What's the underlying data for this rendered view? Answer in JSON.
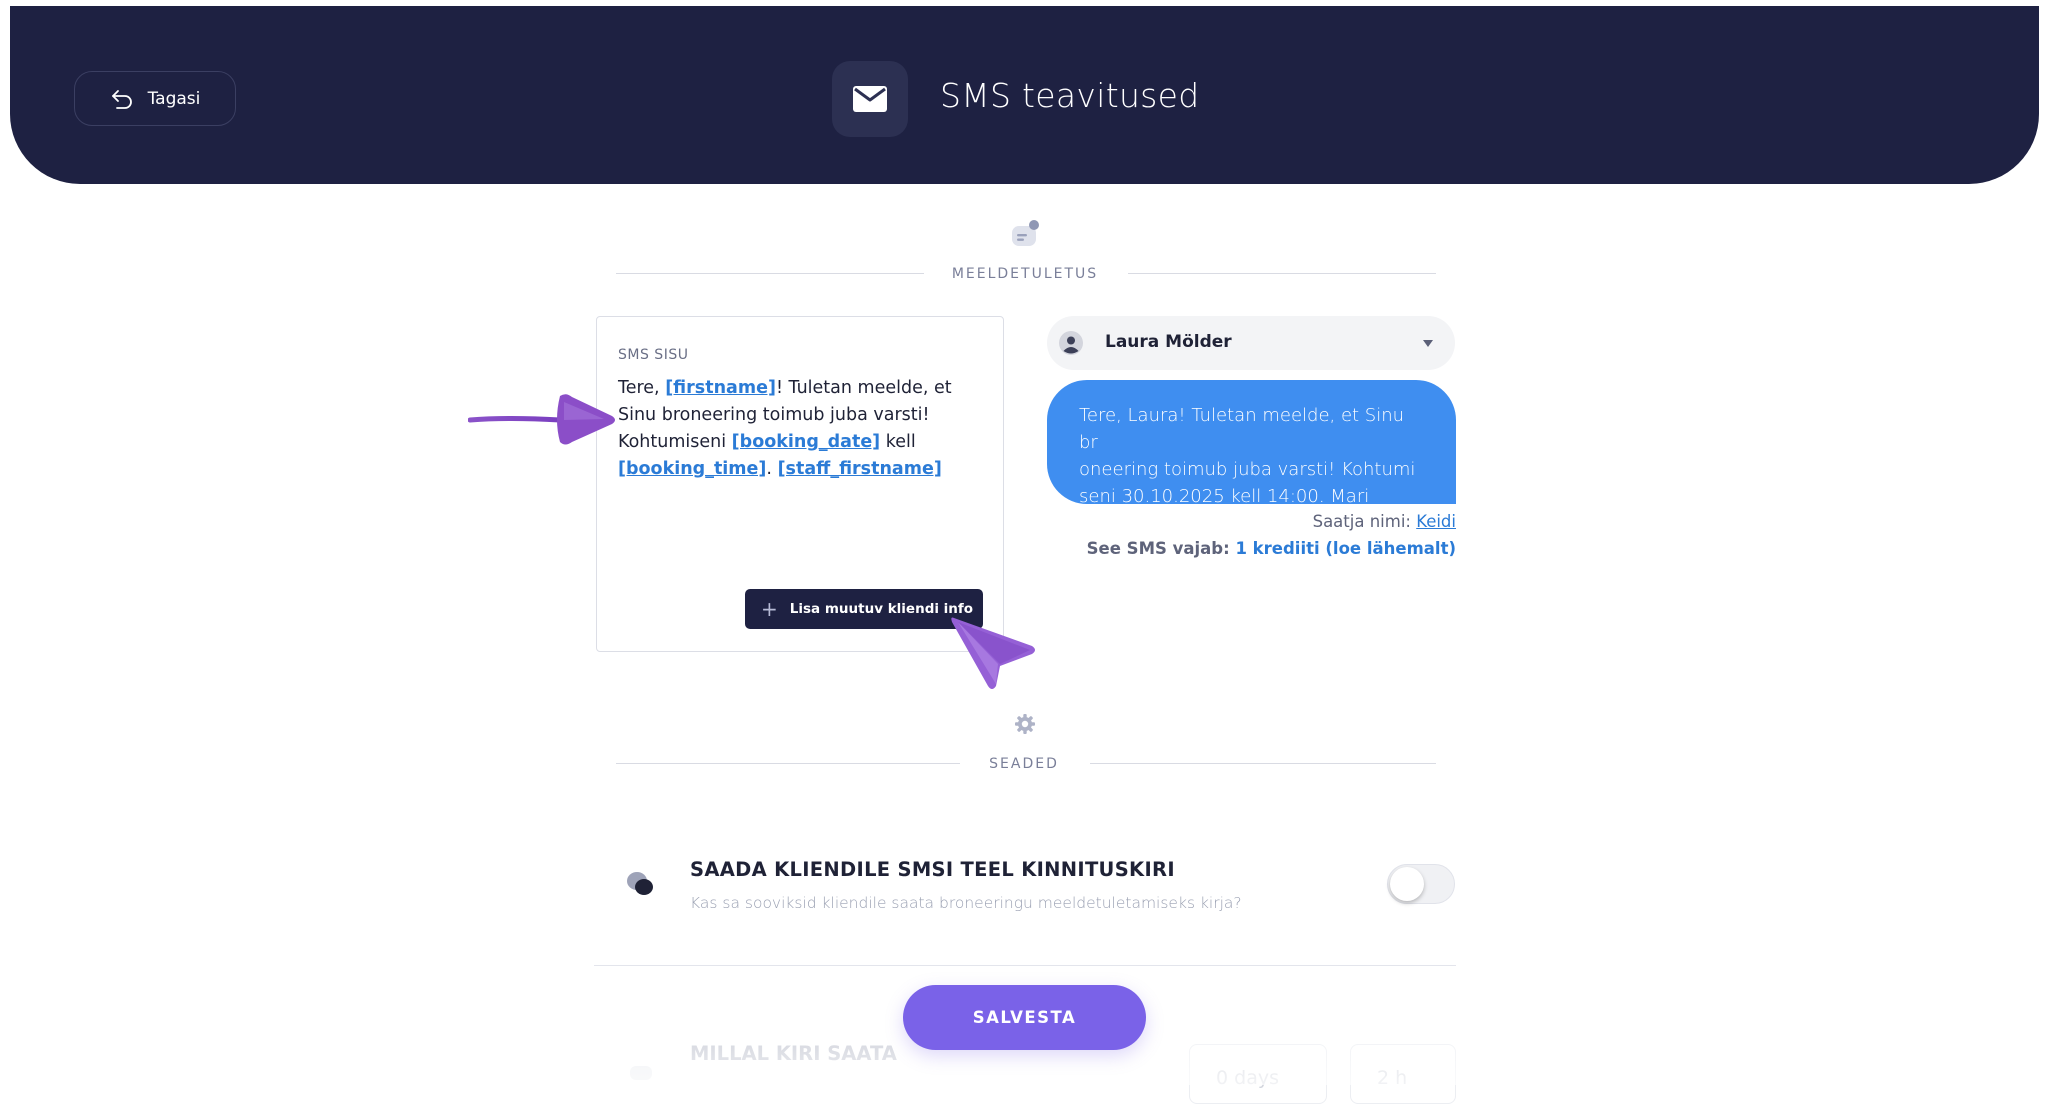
{
  "header": {
    "back_label": "Tagasi",
    "title": "SMS teavitused",
    "title_icon": "envelope-icon"
  },
  "sections": {
    "reminder_label": "MEELDETULETUS",
    "settings_label": "SEADED"
  },
  "editor": {
    "label": "SMS SISU",
    "text_parts": {
      "p1": "Tere, ",
      "tag_firstname": "[firstname]",
      "p2": "! Tuletan meelde, et Sinu broneering toimub juba varsti! Kohtumiseni ",
      "tag_booking_date": "[booking_date]",
      "p3": " kell ",
      "tag_booking_time": "[booking_time]",
      "p4": ". ",
      "tag_staff_firstname": "[staff_firstname]"
    },
    "add_button_label": "Lisa muutuv kliendi info"
  },
  "preview": {
    "person_name": "Laura Mölder",
    "bubble_line1": "Tere, Laura! Tuletan meelde, et Sinu br",
    "bubble_line2": "oneering toimub juba varsti! Kohtumi",
    "bubble_line3": "seni 30.10.2025 kell 14:00. Mari",
    "sender_label": "Saatja nimi: ",
    "sender_value": "Keidi",
    "credits_label": "See SMS vajab: ",
    "credits_value": "1 krediiti (loe lähemalt)"
  },
  "settings": {
    "confirmation_title": "SAADA KLIENDILE SMSI TEEL KINNITUSKIRI",
    "confirmation_desc": "Kas sa sooviksid kliendile saata broneeringu meeldetuletamiseks kirja?",
    "confirmation_enabled": false,
    "when_title": "MILLAL KIRI SAATA",
    "days_value": "0 days",
    "hours_value": "2 h"
  },
  "save_label": "SALVESTA",
  "colors": {
    "header_bg": "#1e2142",
    "accent": "#7a62e8",
    "bubble": "#3f8ef0",
    "link": "#2b7bd6"
  }
}
